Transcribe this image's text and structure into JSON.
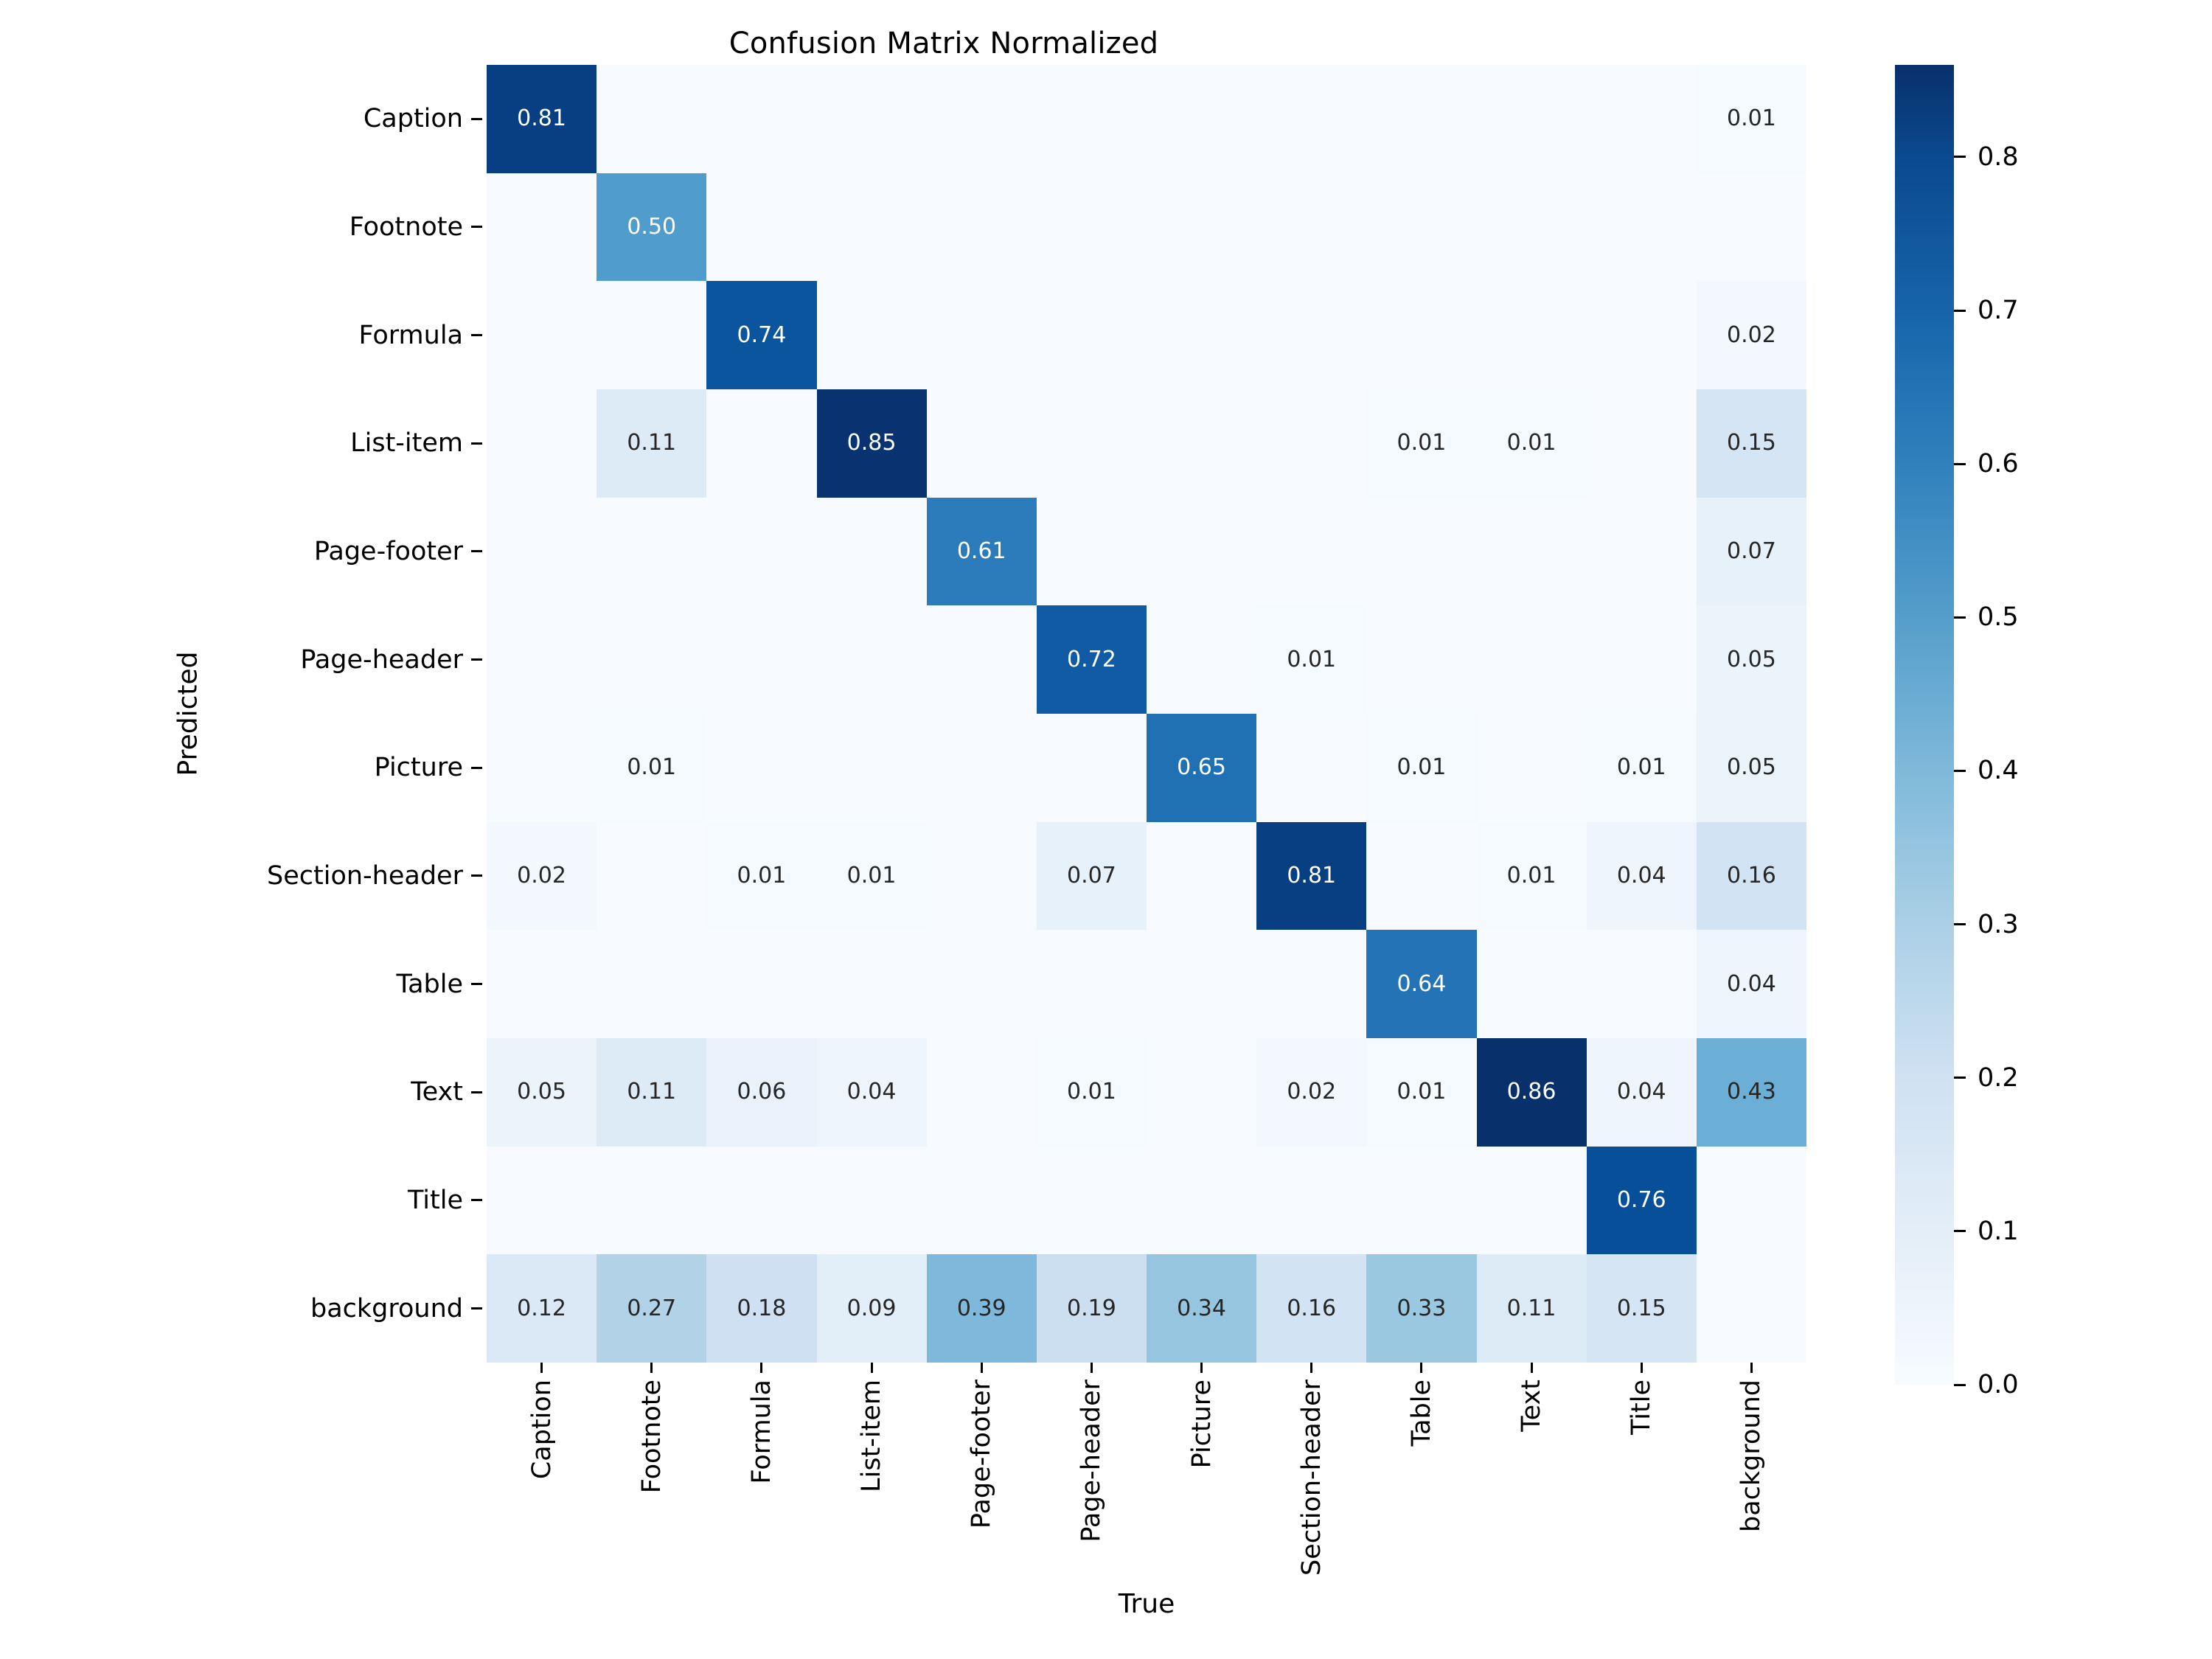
{
  "chart_data": {
    "type": "heatmap",
    "title": "Confusion Matrix Normalized",
    "xlabel": "True",
    "ylabel": "Predicted",
    "colormap": "Blues",
    "value_format": "0.00",
    "grid": false,
    "legend_position": "right-colorbar",
    "colorbar": {
      "ticks": [
        "0.0",
        "0.1",
        "0.2",
        "0.3",
        "0.4",
        "0.5",
        "0.6",
        "0.7",
        "0.8"
      ],
      "tick_values": [
        0.0,
        0.1,
        0.2,
        0.3,
        0.4,
        0.5,
        0.6,
        0.7,
        0.8
      ],
      "vmin": 0.0,
      "vmax": 0.86
    },
    "x_categories": [
      "Caption",
      "Footnote",
      "Formula",
      "List-item",
      "Page-footer",
      "Page-header",
      "Picture",
      "Section-header",
      "Table",
      "Text",
      "Title",
      "background"
    ],
    "y_categories": [
      "Caption",
      "Footnote",
      "Formula",
      "List-item",
      "Page-footer",
      "Page-header",
      "Picture",
      "Section-header",
      "Table",
      "Text",
      "Title",
      "background"
    ],
    "matrix": [
      [
        0.81,
        null,
        null,
        null,
        null,
        null,
        null,
        null,
        null,
        null,
        null,
        0.01
      ],
      [
        null,
        0.5,
        null,
        null,
        null,
        null,
        null,
        null,
        null,
        null,
        null,
        null
      ],
      [
        null,
        null,
        0.74,
        null,
        null,
        null,
        null,
        null,
        null,
        null,
        null,
        0.02
      ],
      [
        null,
        0.11,
        null,
        0.85,
        null,
        null,
        null,
        null,
        0.01,
        0.01,
        null,
        0.15
      ],
      [
        null,
        null,
        null,
        null,
        0.61,
        null,
        null,
        null,
        null,
        null,
        null,
        0.07
      ],
      [
        null,
        null,
        null,
        null,
        null,
        0.72,
        null,
        0.01,
        null,
        null,
        null,
        0.05
      ],
      [
        null,
        0.01,
        null,
        null,
        null,
        null,
        0.65,
        null,
        0.01,
        null,
        0.01,
        0.05
      ],
      [
        0.02,
        null,
        0.01,
        0.01,
        null,
        0.07,
        null,
        0.81,
        null,
        0.01,
        0.04,
        0.16
      ],
      [
        null,
        null,
        null,
        null,
        null,
        null,
        null,
        null,
        0.64,
        null,
        null,
        0.04
      ],
      [
        0.05,
        0.11,
        0.06,
        0.04,
        null,
        0.01,
        null,
        0.02,
        0.01,
        0.86,
        0.04,
        0.43
      ],
      [
        null,
        null,
        null,
        null,
        null,
        null,
        null,
        null,
        null,
        null,
        0.76,
        null
      ],
      [
        0.12,
        0.27,
        0.18,
        0.09,
        0.39,
        0.19,
        0.34,
        0.16,
        0.33,
        0.11,
        0.15,
        null
      ]
    ],
    "cell_labels": [
      [
        "0.81",
        "",
        "",
        "",
        "",
        "",
        "",
        "",
        "",
        "",
        "",
        "0.01"
      ],
      [
        "",
        "0.50",
        "",
        "",
        "",
        "",
        "",
        "",
        "",
        "",
        "",
        ""
      ],
      [
        "",
        "",
        "0.74",
        "",
        "",
        "",
        "",
        "",
        "",
        "",
        "",
        "0.02"
      ],
      [
        "",
        "0.11",
        "",
        "0.85",
        "",
        "",
        "",
        "",
        "0.01",
        "0.01",
        "",
        "0.15"
      ],
      [
        "",
        "",
        "",
        "",
        "0.61",
        "",
        "",
        "",
        "",
        "",
        "",
        "0.07"
      ],
      [
        "",
        "",
        "",
        "",
        "",
        "0.72",
        "",
        "0.01",
        "",
        "",
        "",
        "0.05"
      ],
      [
        "",
        "0.01",
        "",
        "",
        "",
        "",
        "0.65",
        "",
        "0.01",
        "",
        "0.01",
        "0.05"
      ],
      [
        "0.02",
        "",
        "0.01",
        "0.01",
        "",
        "0.07",
        "",
        "0.81",
        "",
        "0.01",
        "0.04",
        "0.16"
      ],
      [
        "",
        "",
        "",
        "",
        "",
        "",
        "",
        "",
        "0.64",
        "",
        "",
        "0.04"
      ],
      [
        "0.05",
        "0.11",
        "0.06",
        "0.04",
        "",
        "0.01",
        "",
        "0.02",
        "0.01",
        "0.86",
        "0.04",
        "0.43"
      ],
      [
        "",
        "",
        "",
        "",
        "",
        "",
        "",
        "",
        "",
        "",
        "0.76",
        ""
      ],
      [
        "0.12",
        "0.27",
        "0.18",
        "0.09",
        "0.39",
        "0.19",
        "0.34",
        "0.16",
        "0.33",
        "0.11",
        "0.15",
        ""
      ]
    ]
  },
  "colors": {
    "text_dark": "#262626",
    "text_light": "#ffffff",
    "background": "#ffffff",
    "cmap_low": "#f7fbff",
    "cmap_high": "#08306b"
  }
}
